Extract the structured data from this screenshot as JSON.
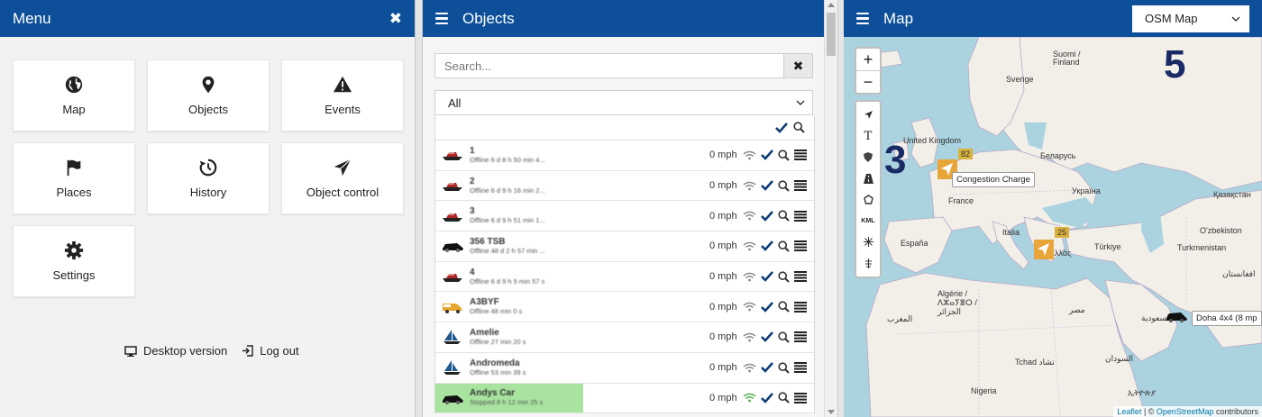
{
  "menu": {
    "title": "Menu",
    "close_symbol": "✖",
    "tiles": [
      {
        "label": "Map",
        "icon": "globe-icon"
      },
      {
        "label": "Objects",
        "icon": "map-pin-icon"
      },
      {
        "label": "Events",
        "icon": "warning-icon"
      },
      {
        "label": "Places",
        "icon": "flag-icon"
      },
      {
        "label": "History",
        "icon": "history-icon"
      },
      {
        "label": "Object control",
        "icon": "send-icon"
      },
      {
        "label": "Settings",
        "icon": "gear-icon"
      }
    ],
    "footer": {
      "desktop": "Desktop version",
      "logout": "Log out"
    }
  },
  "objects": {
    "title": "Objects",
    "search_placeholder": "Search...",
    "filter_value": "All",
    "rows": [
      {
        "name": "1",
        "status": "Offline 6 d 8 h 50 min 4...",
        "speed": "0 mph",
        "vehicle": "boat",
        "active": false
      },
      {
        "name": "2",
        "status": "Offline 6 d 9 h 16 min 2...",
        "speed": "0 mph",
        "vehicle": "boat",
        "active": false
      },
      {
        "name": "3",
        "status": "Offline 6 d 9 h 51 min 1...",
        "speed": "0 mph",
        "vehicle": "boat",
        "active": false
      },
      {
        "name": "356 TSB",
        "status": "Offline 48 d 2 h 57 min ...",
        "speed": "0 mph",
        "vehicle": "car",
        "active": false
      },
      {
        "name": "4",
        "status": "Offline 6 d 9 h 5 min 57 s",
        "speed": "0 mph",
        "vehicle": "boat",
        "active": false
      },
      {
        "name": "A3BYF",
        "status": "Offline 48 min 0 s",
        "speed": "0 mph",
        "vehicle": "van",
        "active": false
      },
      {
        "name": "Amelie",
        "status": "Offline 27 min 20 s",
        "speed": "0 mph",
        "vehicle": "sailboat",
        "active": false
      },
      {
        "name": "Andromeda",
        "status": "Offline 53 min 39 s",
        "speed": "0 mph",
        "vehicle": "sailboat",
        "active": false
      },
      {
        "name": "Andys Car",
        "status": "Stopped 8 h 12 min 25 s",
        "speed": "0 mph",
        "vehicle": "car",
        "active": true
      }
    ],
    "colors": {
      "accent": "#0d4f99",
      "active_row": "#a8e4a0",
      "signal_on": "#4caf50",
      "signal_off": "#8a8a8a"
    }
  },
  "map": {
    "title": "Map",
    "layer_select": "OSM Map",
    "zoom_in": "+",
    "zoom_out": "−",
    "tool_text": "T",
    "tool_kml": "KML",
    "cluster_count_large": "5",
    "cluster_count_medium": "3",
    "cluster_badge_a": "82",
    "cluster_badge_b": "25",
    "tooltip_a": "Congestion Charge",
    "tooltip_b": "Doha 4x4 (8 mp",
    "labels": {
      "suomi": "Suomi /",
      "finland": "Finland",
      "sverige": "Sverige",
      "uk": "United Kingdom",
      "belarus": "Беларусь",
      "ukraine": "Україна",
      "france": "France",
      "espana": "España",
      "italia": "Italia",
      "turkiye": "Türkiye",
      "kazakhstan": "Қазақстан",
      "uzbekistan": "O'zbekiston",
      "turkmenistan": "Turkmenistan",
      "afghanistan": "افغانستان",
      "algeria1": "Algérie /",
      "algeria2": "ⴷⵣⴰⵢⴻⵔ /",
      "algeria3": "الجزائر",
      "morocco": "المغرب",
      "egypt": "مصر",
      "saudi": "السعودية",
      "chad": "Tchad تشاد",
      "sudan": "السودان",
      "nigeria": "Nigeria",
      "ethiopia": "ኢትዮጵያ",
      "greece": "Ελλάς"
    },
    "attribution_leaflet": "Leaflet",
    "attribution_sep": " | © ",
    "attribution_osm": "OpenStreetMap",
    "attribution_tail": " contributors"
  }
}
